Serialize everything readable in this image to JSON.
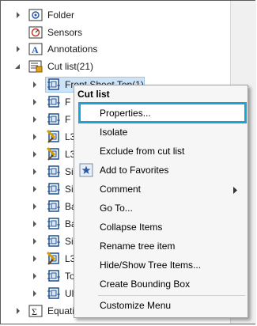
{
  "tree": {
    "items": [
      {
        "label": "Folder",
        "icon": "folder-icon"
      },
      {
        "label": "Sensors",
        "icon": "sensor-icon"
      },
      {
        "label": "Annotations",
        "icon": "annotations-icon"
      },
      {
        "label": "Cut list(21)",
        "icon": "cut-list-icon"
      },
      {
        "label": "Front Sheet Top(1)",
        "icon": "cut-list-item-icon"
      },
      {
        "label": "F",
        "icon": "cut-list-item-icon"
      },
      {
        "label": "F",
        "icon": "cut-list-item-icon"
      },
      {
        "label": "L3",
        "icon": "cut-list-item-warning-icon"
      },
      {
        "label": "L3",
        "icon": "cut-list-item-warning-icon"
      },
      {
        "label": "Si",
        "icon": "cut-list-item-icon"
      },
      {
        "label": "Si",
        "icon": "cut-list-item-icon"
      },
      {
        "label": "Ba",
        "icon": "cut-list-item-icon"
      },
      {
        "label": "Ba",
        "icon": "cut-list-item-icon"
      },
      {
        "label": "Si",
        "icon": "cut-list-item-icon"
      },
      {
        "label": "L3",
        "icon": "cut-list-item-warning-icon"
      },
      {
        "label": "To",
        "icon": "cut-list-item-icon"
      },
      {
        "label": "Ul",
        "icon": "cut-list-item-icon"
      },
      {
        "label": "Equati",
        "icon": "equations-icon"
      }
    ]
  },
  "context_menu": {
    "title": "Cut list",
    "items": [
      {
        "label": "Properties..."
      },
      {
        "label": "Isolate"
      },
      {
        "label": "Exclude from cut list"
      },
      {
        "label": "Add to Favorites",
        "icon": "favorite-star-icon"
      },
      {
        "label": "Comment",
        "has_submenu": true
      },
      {
        "label": "Go To..."
      },
      {
        "label": "Collapse Items"
      },
      {
        "label": "Rename tree item"
      },
      {
        "label": "Hide/Show Tree Items..."
      },
      {
        "label": "Create Bounding Box"
      },
      {
        "label": "Customize Menu"
      }
    ],
    "highlight_color": "#1aa3d9"
  }
}
